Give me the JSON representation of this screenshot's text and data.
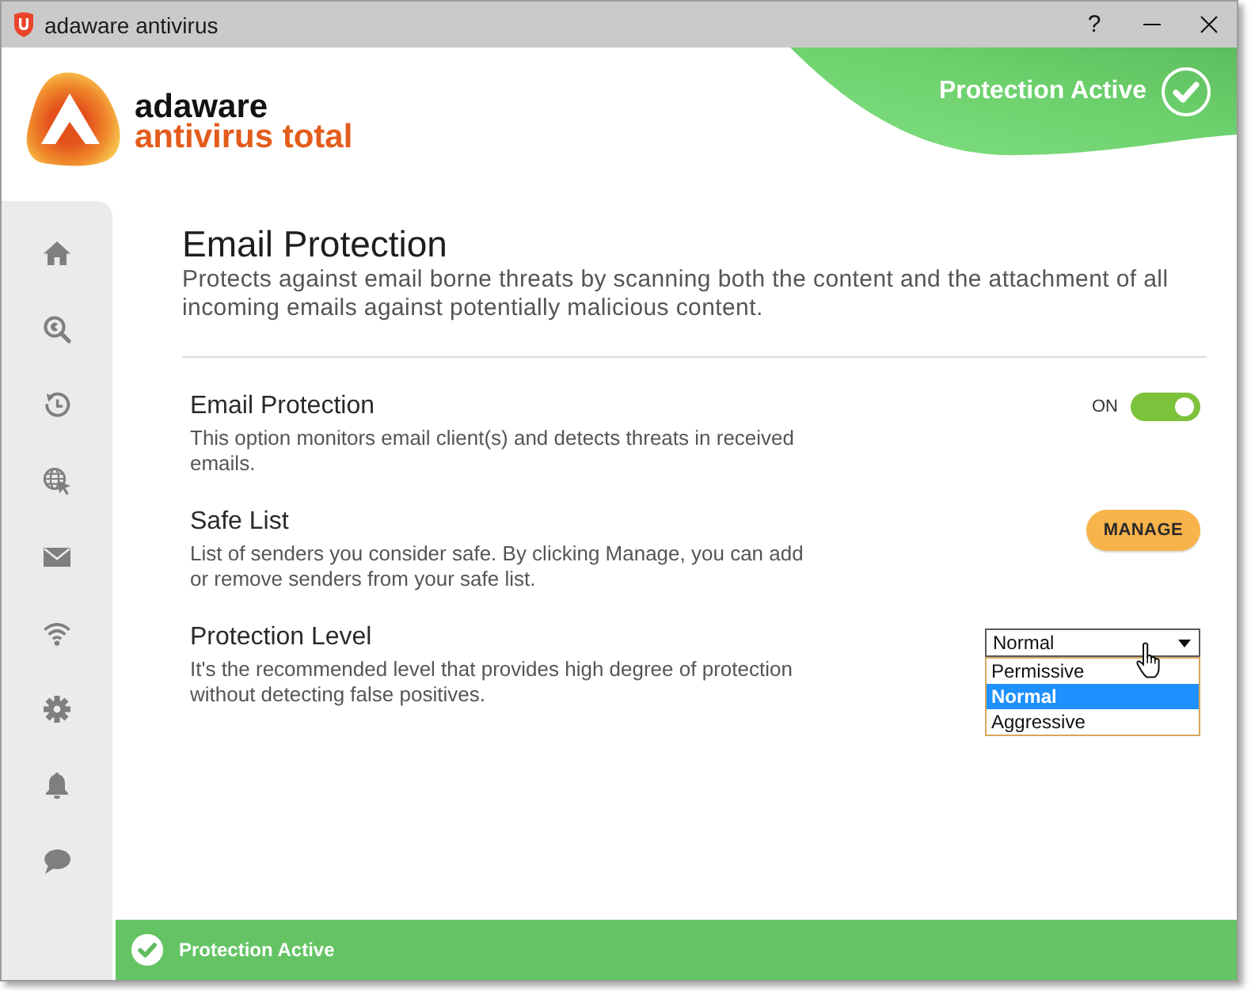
{
  "window": {
    "title": "adaware antivirus",
    "help": "?"
  },
  "header": {
    "brand": "adaware",
    "product": "antivirus total",
    "status": "Protection Active"
  },
  "sidebar": {
    "items": [
      {
        "kind": "home"
      },
      {
        "kind": "scan"
      },
      {
        "kind": "history"
      },
      {
        "kind": "web"
      },
      {
        "kind": "email"
      },
      {
        "kind": "wifi"
      },
      {
        "kind": "settings"
      },
      {
        "kind": "alerts"
      },
      {
        "kind": "chat"
      }
    ]
  },
  "page": {
    "title": "Email Protection",
    "description": "Protects against email borne threats by scanning both the content and the attachment of all incoming emails against potentially malicious content."
  },
  "settings": [
    {
      "kind": "toggle",
      "title": "Email Protection",
      "description": "This option monitors email client(s) and detects threats in received emails.",
      "state_label": "ON",
      "on": true
    },
    {
      "kind": "button",
      "title": "Safe List",
      "description": "List of senders you consider safe. By clicking Manage, you can add or remove senders from your safe list.",
      "button": "MANAGE"
    },
    {
      "kind": "dropdown",
      "title": "Protection Level",
      "description": "It's the recommended level that provides high degree of protection without detecting false positives.",
      "value": "Normal",
      "expanded": true,
      "options": [
        {
          "label": "Permissive",
          "selected": false
        },
        {
          "label": "Normal",
          "selected": true
        },
        {
          "label": "Aggressive",
          "selected": false
        }
      ]
    }
  ],
  "status_bar": {
    "text": "Protection Active"
  }
}
